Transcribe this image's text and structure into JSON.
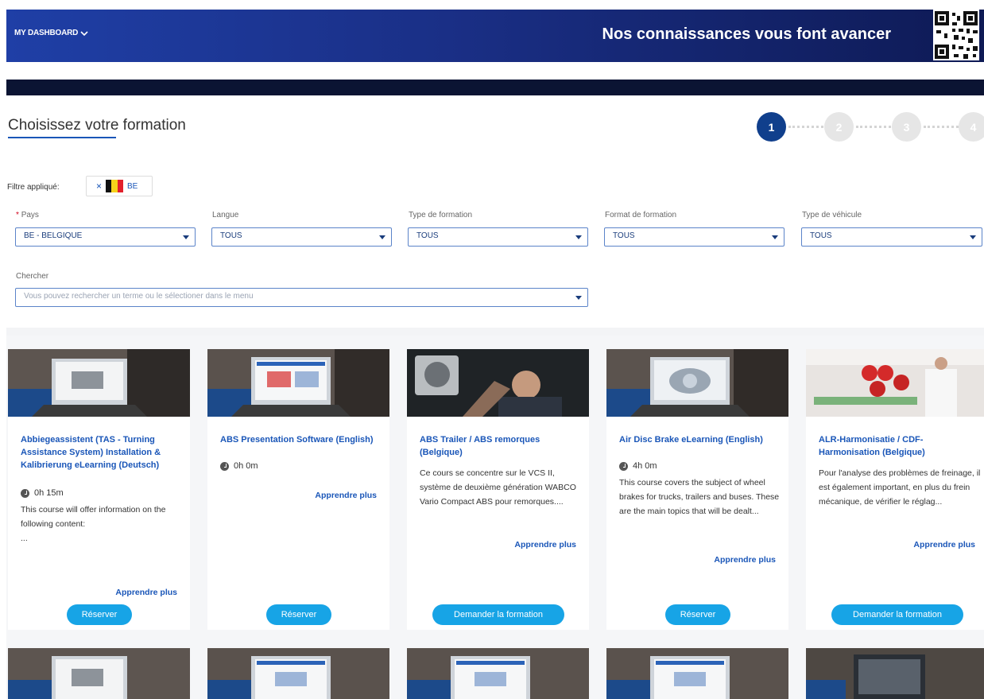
{
  "header": {
    "dashboard_label": "MY DASHBOARD",
    "tagline": "Nos connaissances vous font avancer"
  },
  "page": {
    "title": "Choisissez votre formation"
  },
  "stepper": {
    "steps": [
      "1",
      "2",
      "3",
      "4"
    ],
    "active": 1
  },
  "filter": {
    "label": "Filtre appliqué:",
    "chip_code": "BE",
    "chip_remove": "×"
  },
  "fields": {
    "country": {
      "label": "Pays",
      "required_mark": "*",
      "value": "BE - BELGIQUE"
    },
    "language": {
      "label": "Langue",
      "value": "TOUS"
    },
    "training_type": {
      "label": "Type de formation",
      "value": "TOUS"
    },
    "training_format": {
      "label": "Format de formation",
      "value": "TOUS"
    },
    "vehicle_type": {
      "label": "Type de véhicule",
      "value": "TOUS"
    },
    "search": {
      "label": "Chercher",
      "placeholder": "Vous pouvez rechercher un terme ou le sélectioner dans le menu"
    }
  },
  "cards": [
    {
      "title": "Abbiegeassistent (TAS - Turning Assistance System) Installation & Kalibrierung eLearning (Deutsch)",
      "duration": "0h 15m",
      "description": "This course will offer information on the following content:\n...",
      "more": "Apprendre plus",
      "cta": "Réserver"
    },
    {
      "title": "ABS Presentation Software (English)",
      "duration": "0h 0m",
      "description": "",
      "more": "Apprendre plus",
      "cta": "Réserver"
    },
    {
      "title": "ABS Trailer / ABS remorques (Belgique)",
      "duration": "",
      "description": "Ce cours se concentre sur le VCS II, système de deuxième génération WABCO Vario Compact ABS pour remorques....",
      "more": "Apprendre plus",
      "cta": "Demander la formation"
    },
    {
      "title": "Air Disc Brake eLearning (English)",
      "duration": "4h 0m",
      "description": "This course covers the subject of wheel brakes for trucks, trailers and buses. These are the main topics that will be dealt...",
      "more": "Apprendre plus",
      "cta": "Réserver"
    },
    {
      "title": "ALR-Harmonisatie / CDF-Harmonisation (Belgique)",
      "duration": "",
      "description": "Pour l'analyse des problèmes de freinage, il est également important, en plus du frein mécanique, de vérifier le réglag...",
      "more": "Apprendre plus",
      "cta": "Demander la formation"
    }
  ],
  "colors": {
    "header_start": "#1f3fa6",
    "header_end": "#0e1a55",
    "accent": "#1a56b8",
    "cta": "#17a4e6",
    "step_active": "#103f8c"
  }
}
